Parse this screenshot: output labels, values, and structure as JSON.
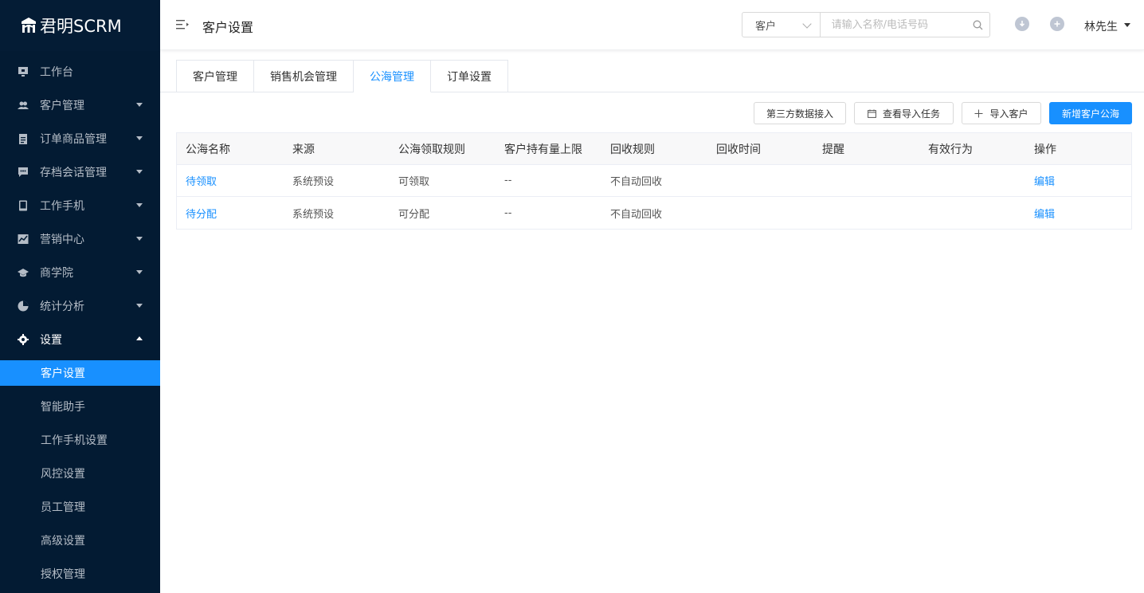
{
  "brand": {
    "name": "君明SCRM"
  },
  "sidebar": {
    "items": [
      {
        "label": "工作台",
        "icon": "monitor-icon",
        "caret": false
      },
      {
        "label": "客户管理",
        "icon": "users-icon",
        "caret": true
      },
      {
        "label": "订单商品管理",
        "icon": "clipboard-icon",
        "caret": true
      },
      {
        "label": "存档会话管理",
        "icon": "chat-icon",
        "caret": true
      },
      {
        "label": "工作手机",
        "icon": "phone-icon",
        "caret": true
      },
      {
        "label": "营销中心",
        "icon": "chart-icon",
        "caret": true
      },
      {
        "label": "商学院",
        "icon": "graduation-icon",
        "caret": true
      },
      {
        "label": "统计分析",
        "icon": "pie-icon",
        "caret": true
      },
      {
        "label": "设置",
        "icon": "gear-icon",
        "caret": true,
        "open": true
      }
    ],
    "sub_items": [
      {
        "label": "客户设置",
        "active": true
      },
      {
        "label": "智能助手"
      },
      {
        "label": "工作手机设置"
      },
      {
        "label": "风控设置"
      },
      {
        "label": "员工管理"
      },
      {
        "label": "高级设置"
      },
      {
        "label": "授权管理"
      }
    ]
  },
  "header": {
    "title": "客户设置",
    "search_type": "客户",
    "search_placeholder": "请输入名称/电话号码",
    "user_name": "林先生"
  },
  "tabs": [
    {
      "label": "客户管理"
    },
    {
      "label": "销售机会管理"
    },
    {
      "label": "公海管理",
      "active": true
    },
    {
      "label": "订单设置"
    }
  ],
  "toolbar": {
    "third_party": "第三方数据接入",
    "view_import": "查看导入任务",
    "import_customer": "导入客户",
    "add_pool": "新增客户公海"
  },
  "table": {
    "columns": [
      "公海名称",
      "来源",
      "公海领取规则",
      "客户持有量上限",
      "回收规则",
      "回收时间",
      "提醒",
      "有效行为",
      "操作"
    ],
    "rows": [
      [
        "待领取",
        "系统预设",
        "可领取",
        "--",
        "不自动回收",
        "",
        "",
        "",
        "编辑"
      ],
      [
        "待分配",
        "系统预设",
        "可分配",
        "--",
        "不自动回收",
        "",
        "",
        "",
        "编辑"
      ]
    ]
  },
  "colors": {
    "accent": "#1890ff",
    "sidebar_bg": "#031b33"
  }
}
